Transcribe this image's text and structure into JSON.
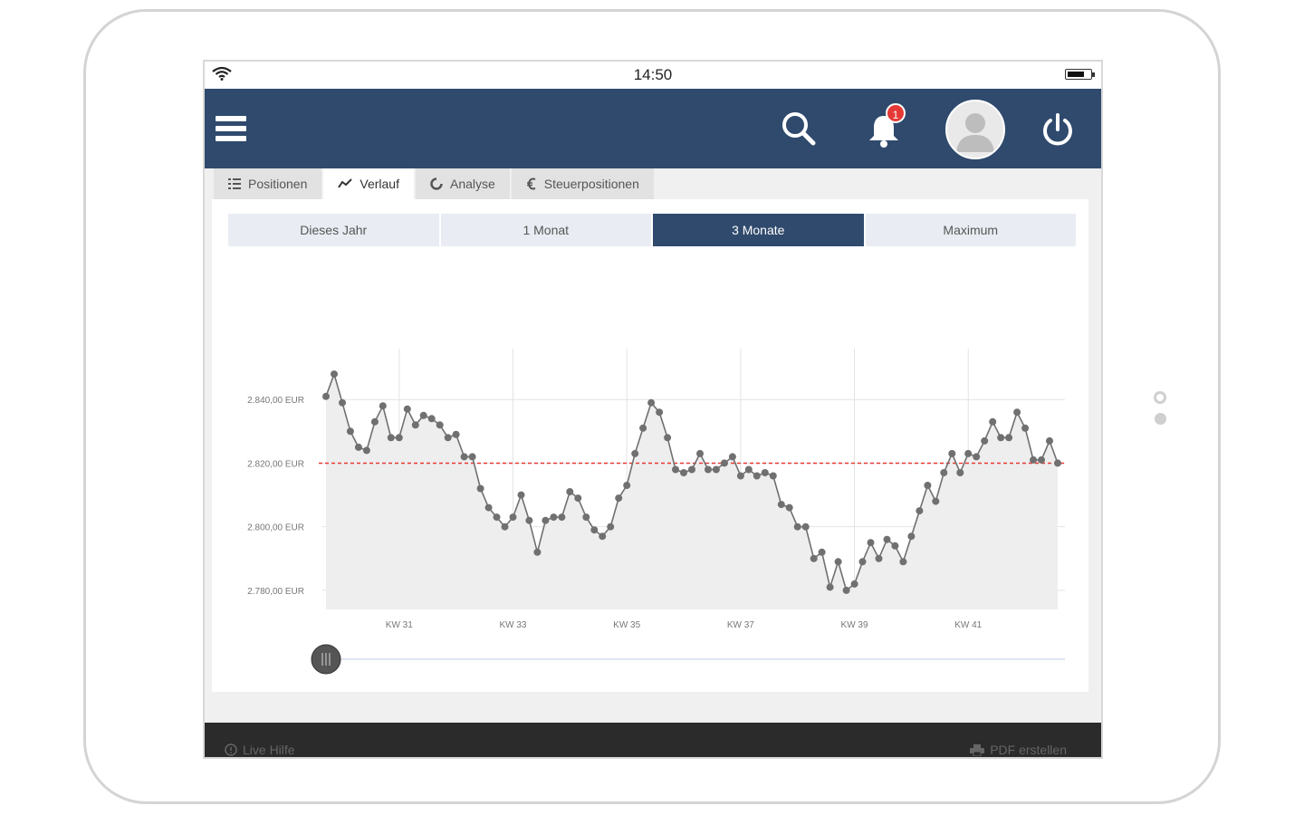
{
  "status_bar": {
    "time": "14:50"
  },
  "header": {
    "notification_count": "1"
  },
  "tabs": [
    {
      "label": "Positionen",
      "icon": "list-icon",
      "active": false
    },
    {
      "label": "Verlauf",
      "icon": "line-chart-icon",
      "active": true
    },
    {
      "label": "Analyse",
      "icon": "pie-chart-icon",
      "active": false
    },
    {
      "label": "Steuerpositionen",
      "icon": "euro-icon",
      "active": false
    }
  ],
  "periods": [
    {
      "label": "Dieses Jahr",
      "active": false
    },
    {
      "label": "1 Monat",
      "active": false
    },
    {
      "label": "3 Monate",
      "active": true
    },
    {
      "label": "Maximum",
      "active": false
    }
  ],
  "footer": {
    "help_label": "Live Hilfe",
    "pdf_label": "PDF erstellen"
  },
  "colors": {
    "header": "#2f4a6d",
    "active_period": "#2f4a6d",
    "reference_line": "#e53935",
    "series": "#707070"
  },
  "chart_data": {
    "type": "line",
    "y_tick_labels": [
      "2.840,00 EUR",
      "2.820,00 EUR",
      "2.800,00 EUR",
      "2.780,00 EUR"
    ],
    "y_ticks": [
      2840,
      2820,
      2800,
      2780
    ],
    "ylim": [
      2774,
      2856
    ],
    "x_tick_labels": [
      "KW 31",
      "KW 33",
      "KW 35",
      "KW 37",
      "KW 39",
      "KW 41"
    ],
    "x_ticks": [
      9,
      23,
      37,
      51,
      65,
      79
    ],
    "reference_value": 2820,
    "series": [
      {
        "values": [
          2841,
          2848,
          2839,
          2830,
          2825,
          2824,
          2833,
          2838,
          2828,
          2828,
          2837,
          2832,
          2835,
          2834,
          2832,
          2828,
          2829,
          2822,
          2822,
          2812,
          2806,
          2803,
          2800,
          2803,
          2810,
          2802,
          2792,
          2802,
          2803,
          2803,
          2811,
          2809,
          2803,
          2799,
          2797,
          2800,
          2809,
          2813,
          2823,
          2831,
          2839,
          2836,
          2828,
          2818,
          2817,
          2818,
          2823,
          2818,
          2818,
          2820,
          2822,
          2816,
          2818,
          2816,
          2817,
          2816,
          2807,
          2806,
          2800,
          2800,
          2790,
          2792,
          2781,
          2789,
          2780,
          2782,
          2789,
          2795,
          2790,
          2796,
          2794,
          2789,
          2797,
          2805,
          2813,
          2808,
          2817,
          2823,
          2817,
          2823,
          2822,
          2827,
          2833,
          2828,
          2828,
          2836,
          2831,
          2821,
          2821,
          2827,
          2820
        ]
      }
    ]
  }
}
